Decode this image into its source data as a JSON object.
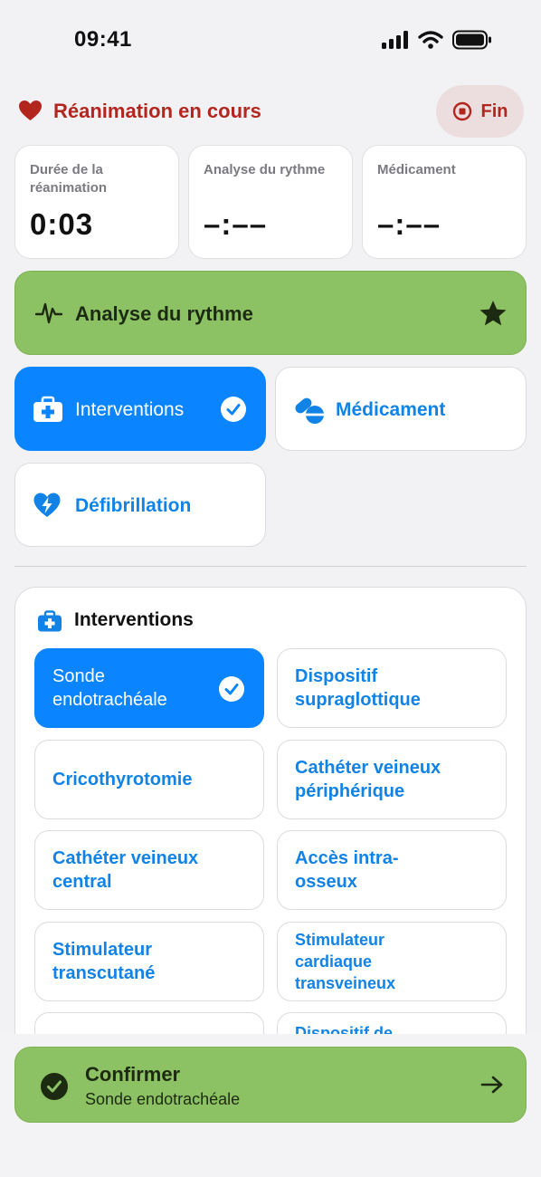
{
  "status": {
    "time": "09:41"
  },
  "header": {
    "title": "Réanimation en cours",
    "end_label": "Fin"
  },
  "timers": [
    {
      "label": "Durée de la réanimation",
      "value": "0:03"
    },
    {
      "label": "Analyse du rythme",
      "value": "–:––"
    },
    {
      "label": "Médicament",
      "value": "–:––"
    }
  ],
  "rhythm": {
    "label": "Analyse du rythme"
  },
  "categories": [
    {
      "label": "Interventions",
      "selected": true,
      "icon": "medkit-icon"
    },
    {
      "label": "Médicament",
      "selected": false,
      "icon": "pills-icon"
    },
    {
      "label": "Défibrillation",
      "selected": false,
      "icon": "heart-bolt-icon"
    }
  ],
  "panel": {
    "title": "Interventions",
    "options": [
      {
        "label": "Sonde endotrachéale",
        "selected": true
      },
      {
        "label": "Dispositif supraglottique",
        "selected": false
      },
      {
        "label": "Cricothyrotomie",
        "selected": false
      },
      {
        "label": "Cathéter veineux périphérique",
        "selected": false
      },
      {
        "label": "Cathéter veineux central",
        "selected": false
      },
      {
        "label": "Accès intra-osseux",
        "selected": false
      },
      {
        "label": "Stimulateur transcutané",
        "selected": false
      },
      {
        "label": "Stimulateur cardiaque transveineux",
        "selected": false
      },
      {
        "label": "",
        "selected": false
      },
      {
        "label": "Dispositif de",
        "selected": false
      }
    ]
  },
  "confirm": {
    "title": "Confirmer",
    "subtitle": "Sonde endotrachéale"
  },
  "colors": {
    "accent": "#0a84ff",
    "danger": "#b3261e",
    "success": "#8dc264"
  }
}
